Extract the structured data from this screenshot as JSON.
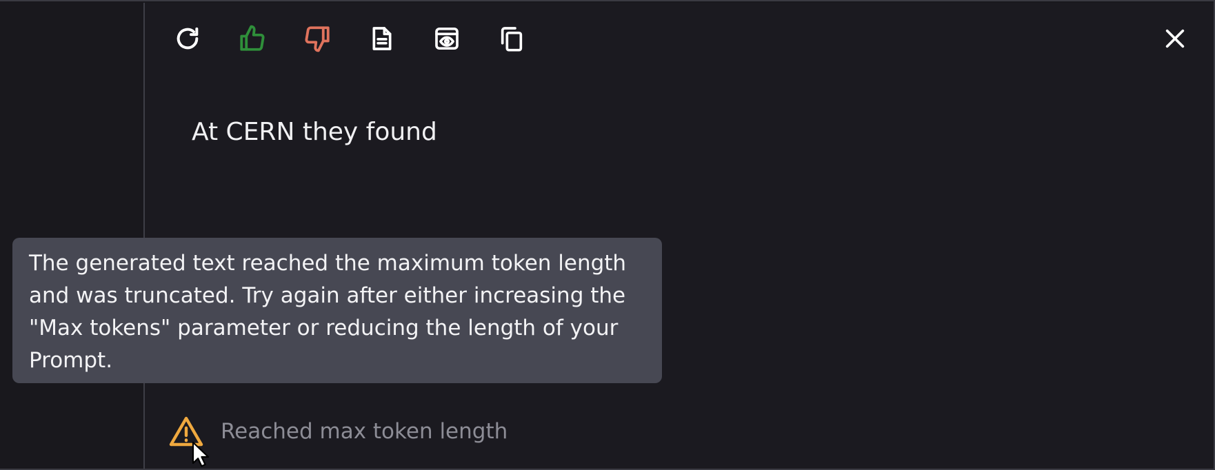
{
  "toolbar": {
    "icons": [
      "refresh-icon",
      "thumbs-up-icon",
      "thumbs-down-icon",
      "document-icon",
      "preview-icon",
      "copy-icon",
      "close-icon"
    ],
    "colors": {
      "default": "#ffffff",
      "thumbs_up": "#2f8f3a",
      "thumbs_down": "#e0735d"
    }
  },
  "output": {
    "text": "At CERN they found"
  },
  "tooltip": {
    "text": "The generated text reached the maximum token length and was truncated. Try again after either increasing the \"Max tokens\" parameter or reducing the length of your Prompt."
  },
  "warning": {
    "icon": "warning-triangle-icon",
    "color": "#f0a93f",
    "text": "Reached max token length"
  },
  "colors": {
    "background": "#19181d",
    "panel": "#1b1a20",
    "tooltip_bg": "#474853",
    "divider": "#3e3e46"
  }
}
